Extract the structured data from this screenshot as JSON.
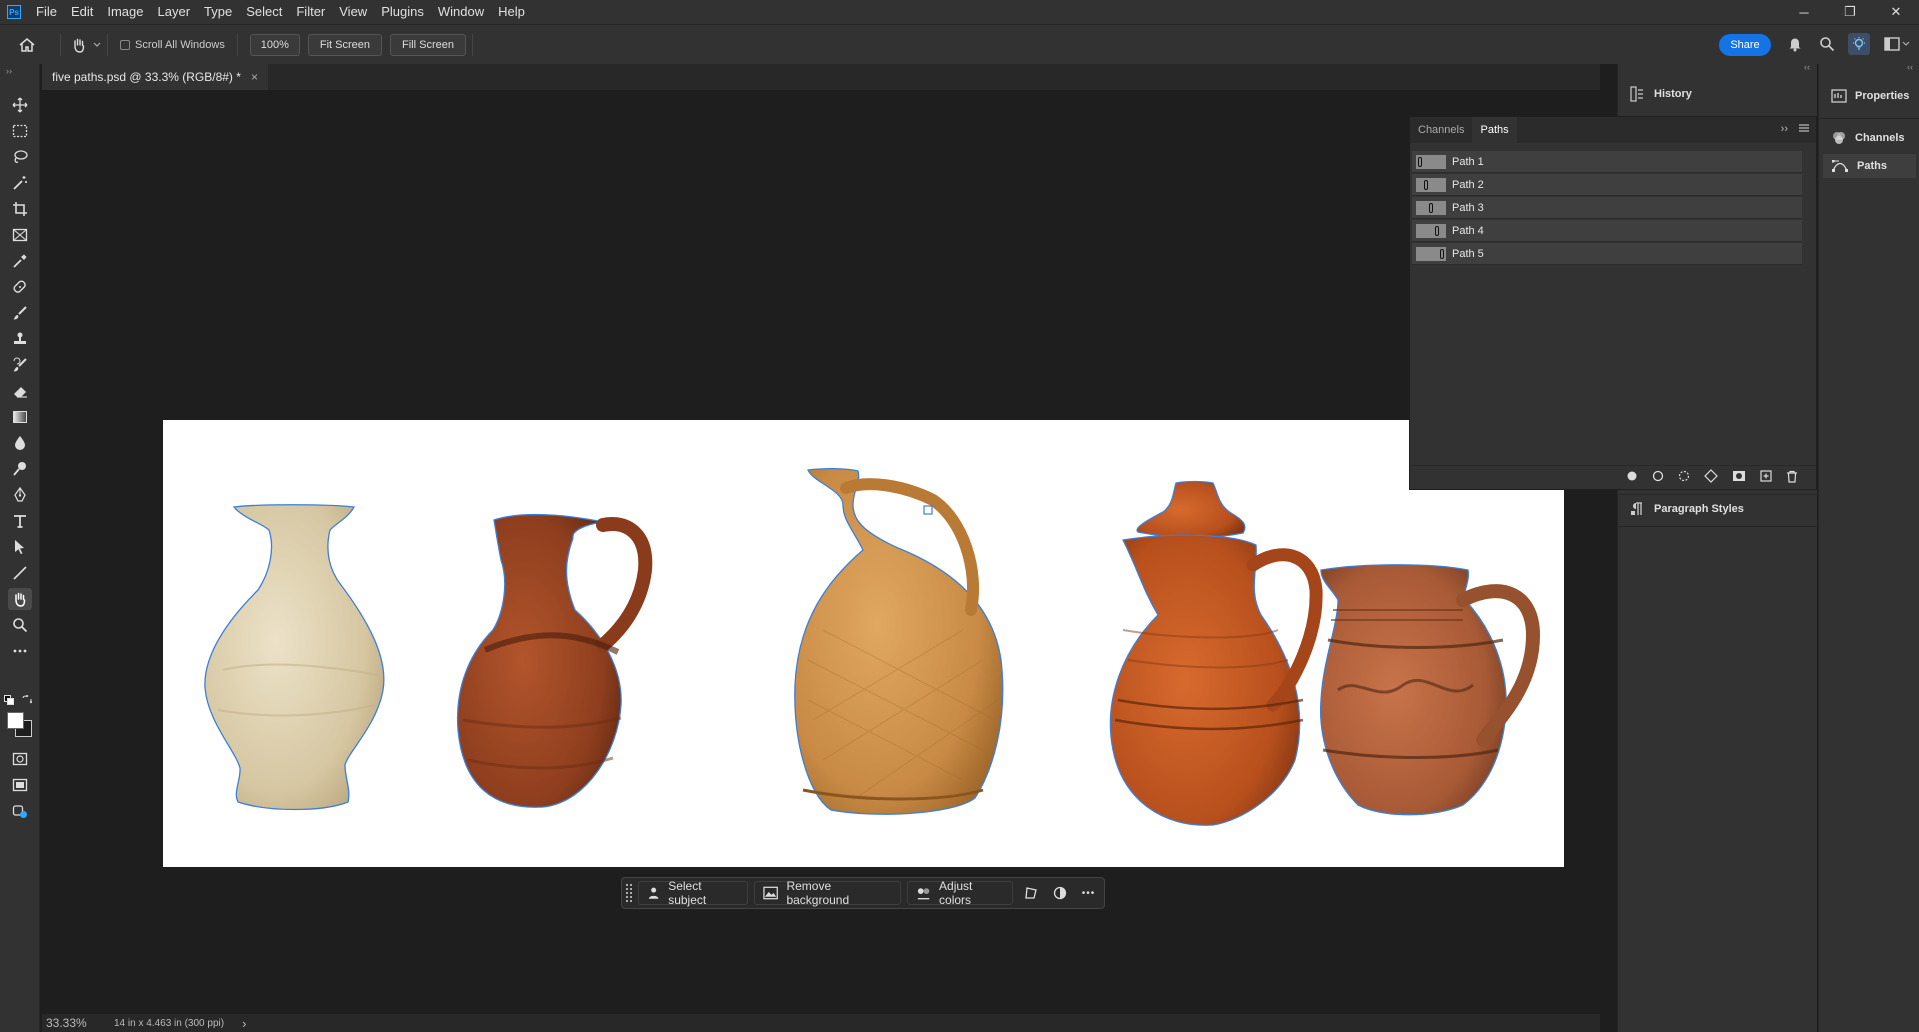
{
  "app": {
    "logo": "Ps"
  },
  "menu": [
    "File",
    "Edit",
    "Image",
    "Layer",
    "Type",
    "Select",
    "Filter",
    "View",
    "Plugins",
    "Window",
    "Help"
  ],
  "window_controls": {
    "minimize": "─",
    "restore": "❐",
    "close": "✕"
  },
  "options_bar": {
    "scroll_all_windows": "Scroll All Windows",
    "zoom": "100%",
    "fit_screen": "Fit Screen",
    "fill_screen": "Fill Screen",
    "share": "Share"
  },
  "document": {
    "tab_title": "five paths.psd @ 33.3% (RGB/8#) *",
    "tab_close": "×"
  },
  "contextual_bar": {
    "select_subject": "Select subject",
    "remove_background": "Remove background",
    "adjust_colors": "Adjust colors",
    "more": "•••"
  },
  "status_bar": {
    "zoom": "33.33%",
    "doc_info": "14 in x 4.463 in (300 ppi)",
    "arrow": "›"
  },
  "panels": {
    "history": "History",
    "paragraph_styles": "Paragraph Styles",
    "properties": "Properties",
    "channels": "Channels",
    "paths": "Paths"
  },
  "paths_panel": {
    "tabs": [
      "Channels",
      "Paths"
    ],
    "active_tab": "Paths",
    "paths": [
      "Path 1",
      "Path 2",
      "Path 3",
      "Path 4",
      "Path 5"
    ]
  },
  "colors": {
    "accent": "#1473e6",
    "path_outline": "#3b7fd8",
    "bg_dark": "#1e1e1e",
    "panel": "#323232"
  },
  "icons": [
    "home-icon",
    "hand-icon",
    "bell-icon",
    "search-icon",
    "lightbulb-icon",
    "workspace-icon"
  ]
}
